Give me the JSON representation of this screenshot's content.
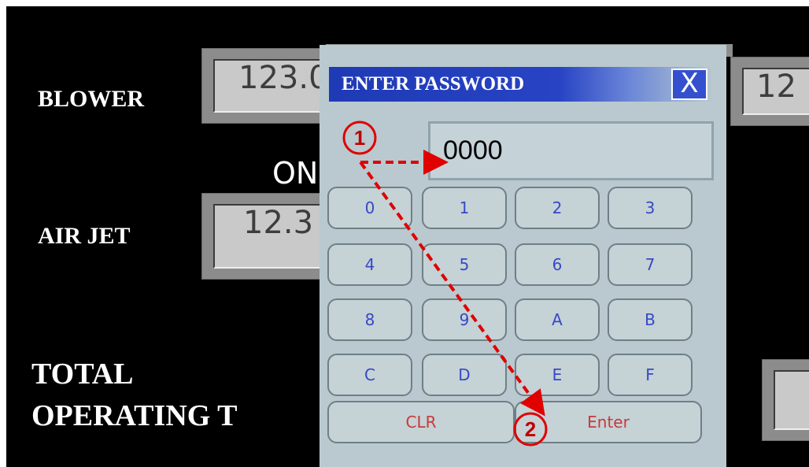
{
  "background_labels": {
    "blower": "BLOWER",
    "on": "ON",
    "air_jet": "AIR JET",
    "total": "TOTAL",
    "operating": "OPERATING T"
  },
  "background_values": {
    "blower_value": "123.0",
    "air_jet_value": "12.3",
    "right_value": "12"
  },
  "dialog": {
    "title": "ENTER PASSWORD",
    "close_symbol": "X",
    "password_value": "0000",
    "keys": [
      [
        "0",
        "1",
        "2",
        "3"
      ],
      [
        "4",
        "5",
        "6",
        "7"
      ],
      [
        "8",
        "9",
        "A",
        "B"
      ],
      [
        "C",
        "D",
        "E",
        "F"
      ]
    ],
    "clear_label": "CLR",
    "enter_label": "Enter"
  },
  "annotations": {
    "step1": "1",
    "step2": "2"
  },
  "colors": {
    "annotation": "#e00000",
    "title_bar": "#1f3ab5",
    "key_text": "#3748c6"
  }
}
